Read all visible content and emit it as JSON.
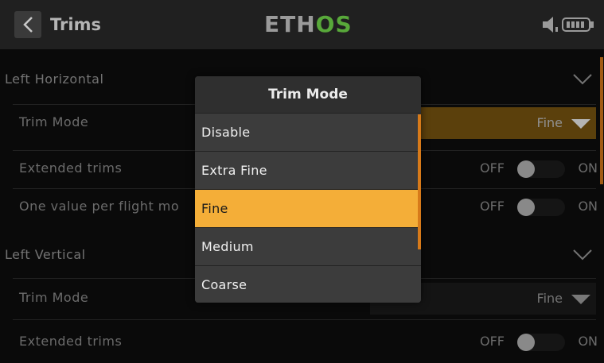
{
  "header": {
    "title": "Trims",
    "logo_main": "ETH",
    "logo_accent": "OS"
  },
  "sections": [
    {
      "title": "Left Horizontal",
      "trim_mode": {
        "label": "Trim Mode",
        "value": "Fine"
      },
      "extended_trims": {
        "label": "Extended trims",
        "off": "OFF",
        "on": "ON"
      },
      "per_flight_mode": {
        "label": "One value per flight mo",
        "off": "OFF",
        "on": "ON"
      }
    },
    {
      "title": "Left Vertical",
      "trim_mode": {
        "label": "Trim Mode",
        "value": "Fine"
      },
      "extended_trims": {
        "label": "Extended trims",
        "off": "OFF",
        "on": "ON"
      }
    }
  ],
  "modal": {
    "title": "Trim Mode",
    "options": [
      "Disable",
      "Extra Fine",
      "Fine",
      "Medium",
      "Coarse"
    ],
    "selected": "Fine"
  },
  "colors": {
    "accent": "#f4ae38",
    "logo_green": "#58a83a",
    "scrollbar": "#d77a1a"
  },
  "icons": {
    "back": "chevron-left-icon",
    "audio": "speaker-icon",
    "battery": "battery-icon",
    "expand": "chevron-down-icon",
    "dropdown": "triangle-down-icon"
  }
}
